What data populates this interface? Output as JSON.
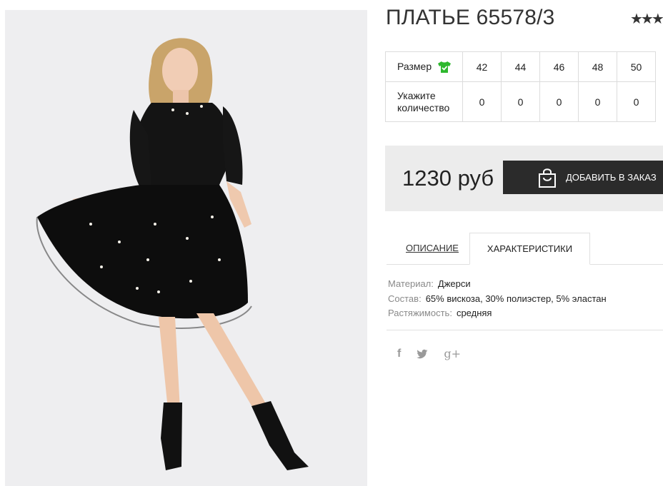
{
  "product": {
    "title": "ПЛАТЬЕ 65578/3",
    "rating_stars": "★★★",
    "photo_alt": ""
  },
  "sizes": {
    "size_row_label": "Размер",
    "qty_row_label": "Укажите количество",
    "sizes": [
      "42",
      "44",
      "46",
      "48",
      "50"
    ],
    "quantities": [
      "0",
      "0",
      "0",
      "0",
      "0"
    ]
  },
  "purchase": {
    "price": "1230 руб",
    "add_button_label": "ДОБАВИТЬ В ЗАКАЗ"
  },
  "tabs": {
    "description_label": "ОПИСАНИЕ",
    "characteristics_label": "ХАРАКТЕРИСТИКИ",
    "active": "characteristics"
  },
  "characteristics": [
    {
      "key": "Материал:",
      "value": "Джерси"
    },
    {
      "key": "Состав:",
      "value": "65% вискоза, 30% полиэстер, 5% эластан"
    },
    {
      "key": "Растяжимость:",
      "value": "средняя"
    }
  ],
  "social": {
    "facebook": "f",
    "twitter": "twitter-icon",
    "googleplus": "g+"
  },
  "colors": {
    "button_bg": "#2b2b2b",
    "price_bg": "#ececec",
    "size_icon": "#2eb82e"
  }
}
